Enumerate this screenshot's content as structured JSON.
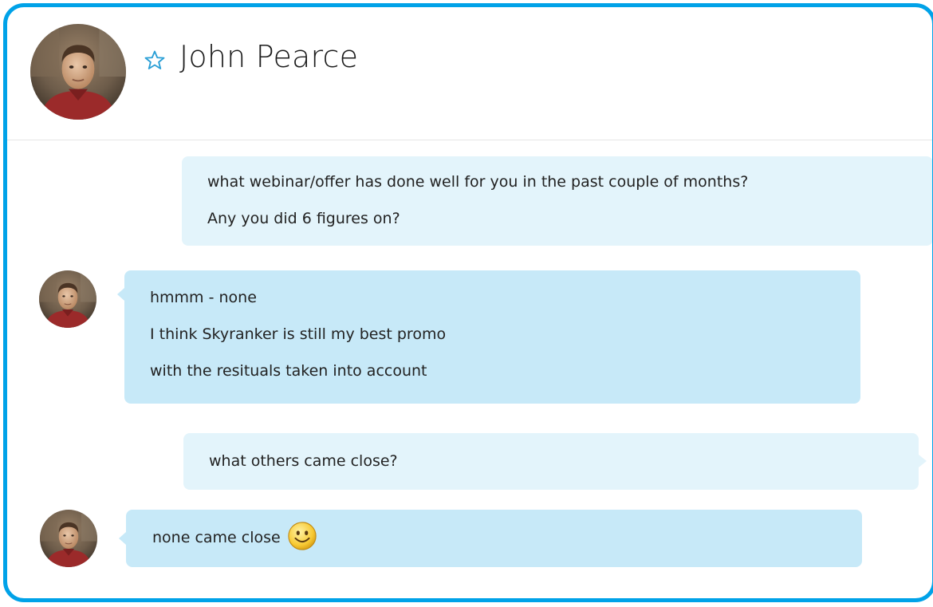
{
  "header": {
    "contact_name": "John Pearce",
    "favorite_icon": "star-outline-icon",
    "avatar": "contact-photo"
  },
  "messages": [
    {
      "direction": "outgoing",
      "lines": [
        "what webinar/offer has done well for you in the past couple of months?",
        "Any you did 6 figures on?"
      ]
    },
    {
      "direction": "incoming",
      "lines": [
        "hmmm - none",
        "I think Skyranker is still my best promo",
        "with the resituals taken into account"
      ]
    },
    {
      "direction": "outgoing",
      "lines": [
        "what others came close?"
      ]
    },
    {
      "direction": "incoming",
      "lines": [
        "none came close"
      ],
      "emoticon": "smiley-icon"
    }
  ],
  "colors": {
    "frame_border": "#00a2e8",
    "outgoing_bubble": "#e3f4fb",
    "incoming_bubble": "#c7e9f8",
    "star": "#2a9fd6"
  }
}
